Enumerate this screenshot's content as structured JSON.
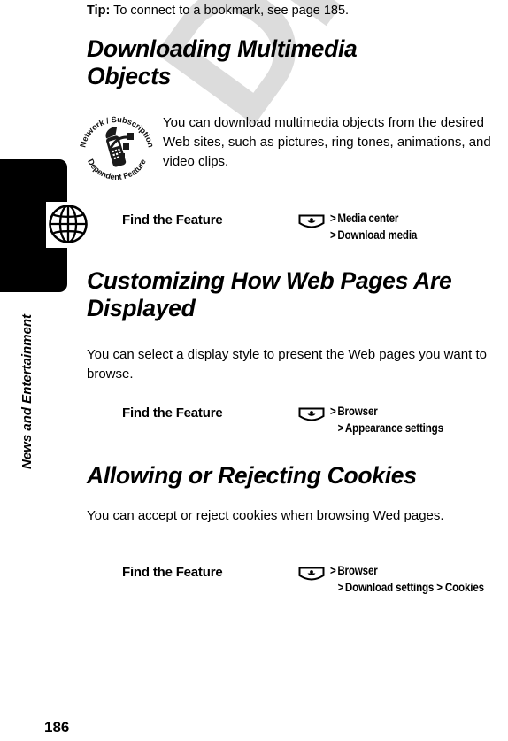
{
  "document": {
    "page_number": "186",
    "chapter_title": "News and Entertainment",
    "watermark_text": "DRAFT",
    "watermark_color": "#dcdcdc"
  },
  "tip": {
    "label": "Tip:",
    "text": " To connect to a bookmark, see page 185."
  },
  "sections": [
    {
      "heading": "Downloading Multimedia Objects",
      "body": "You can download multimedia objects from the desired Web sites, such as pictures, ring tones, animations, and video clips.",
      "badge_icon": "network-subscription-dependent-feature-icon",
      "badge_text_top": "Network / Subscription",
      "badge_text_bottom": "Dependent Feature",
      "find_the_feature": {
        "label": "Find the Feature",
        "key_icon": "center-select-key-icon",
        "path_lines": [
          {
            "separator": ">",
            "item": "Media center",
            "indent": false
          },
          {
            "separator": ">",
            "item": "Download media",
            "indent": false
          }
        ]
      }
    },
    {
      "heading": "Customizing How Web Pages Are Displayed",
      "body": "You can select a display style to present the Web pages you want to browse.",
      "find_the_feature": {
        "label": "Find the Feature",
        "key_icon": "center-select-key-icon",
        "path_lines": [
          {
            "separator": ">",
            "item": "Browser",
            "indent": false
          },
          {
            "separator": ">",
            "item": "Appearance settings",
            "indent": true
          }
        ]
      }
    },
    {
      "heading": "Allowing or Rejecting Cookies",
      "body": "You can accept or reject cookies when browsing Wed pages.",
      "find_the_feature": {
        "label": "Find the Feature",
        "key_icon": "center-select-key-icon",
        "path_lines": [
          {
            "separator": ">",
            "item": "Browser",
            "indent": false
          },
          {
            "separator": ">",
            "item": "Download settings >  Cookies",
            "indent": true
          }
        ]
      }
    }
  ],
  "chapter_tab": {
    "icon": "globe-icon"
  }
}
